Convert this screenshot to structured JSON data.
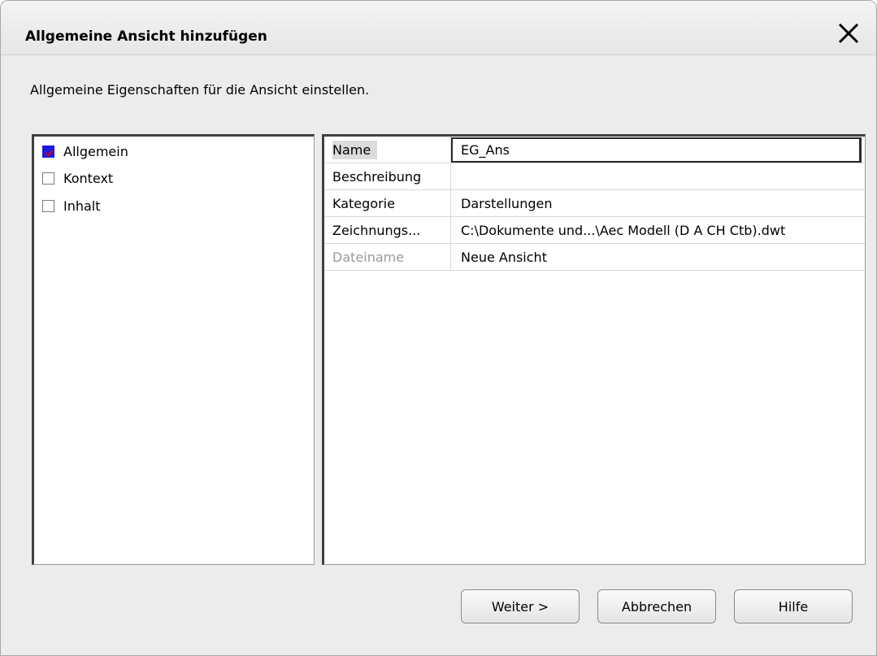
{
  "dialog": {
    "title": "Allgemeine Ansicht hinzufügen",
    "subtitle": "Allgemeine Eigenschaften für die Ansicht einstellen."
  },
  "tree": [
    {
      "label": "Allgemein",
      "checked": true
    },
    {
      "label": "Kontext",
      "checked": false
    },
    {
      "label": "Inhalt",
      "checked": false
    }
  ],
  "properties": [
    {
      "label": "Name",
      "value": "EG_Ans"
    },
    {
      "label": "Beschreibung",
      "value": ""
    },
    {
      "label": "Kategorie",
      "value": "Darstellungen"
    },
    {
      "label": "Zeichnungs...",
      "value": "C:\\Dokumente und...\\Aec Modell (D A CH Ctb).dwt"
    },
    {
      "label": "Dateiname",
      "value": "Neue Ansicht"
    }
  ],
  "buttons": {
    "next": "Weiter >",
    "cancel": "Abbrechen",
    "help": "Hilfe"
  },
  "icons": {
    "close": "close-icon"
  }
}
